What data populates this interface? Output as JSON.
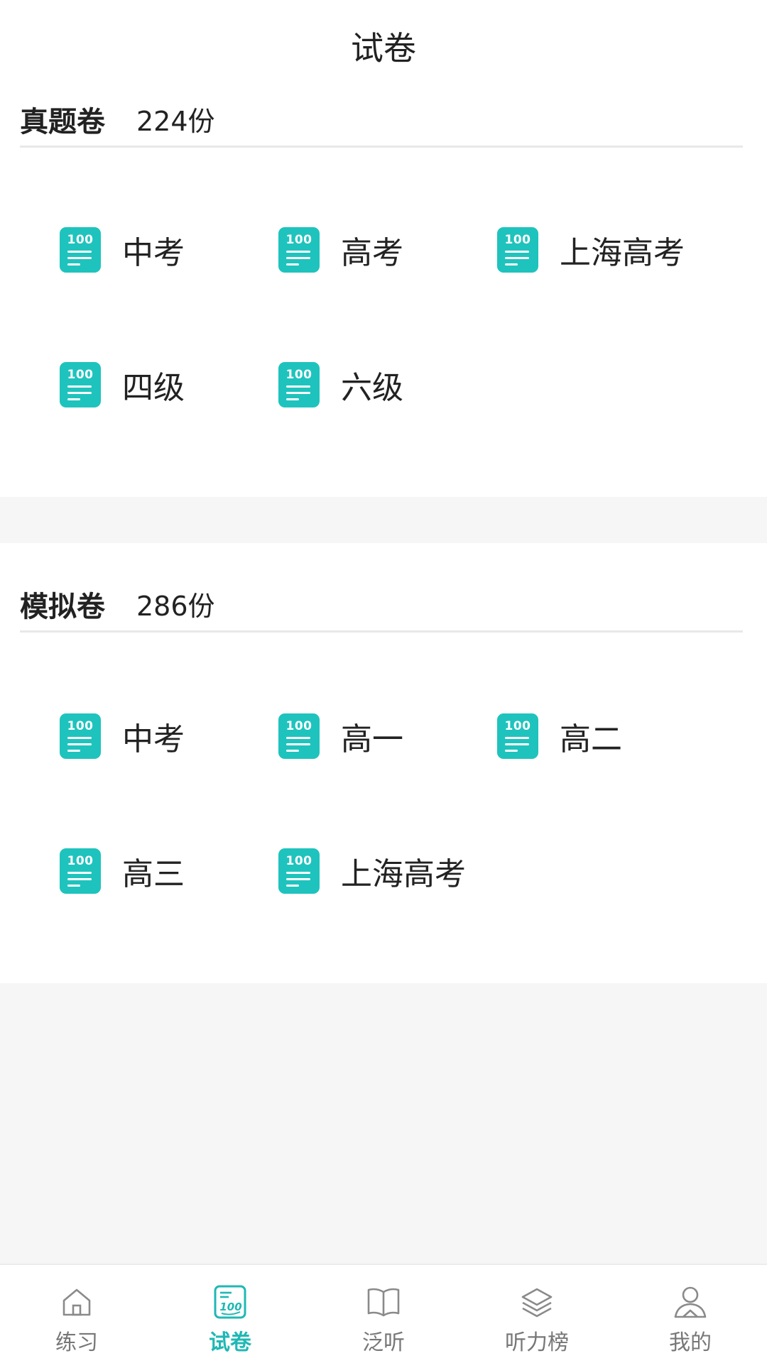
{
  "header": {
    "title": "试卷"
  },
  "sections": [
    {
      "name": "真题卷",
      "count": "224份",
      "items": [
        {
          "icon_text": "100",
          "label": "中考"
        },
        {
          "icon_text": "100",
          "label": "高考"
        },
        {
          "icon_text": "100",
          "label": "上海高考"
        },
        {
          "icon_text": "100",
          "label": "四级"
        },
        {
          "icon_text": "100",
          "label": "六级"
        }
      ]
    },
    {
      "name": "模拟卷",
      "count": "286份",
      "items": [
        {
          "icon_text": "100",
          "label": "中考"
        },
        {
          "icon_text": "100",
          "label": "高一"
        },
        {
          "icon_text": "100",
          "label": "高二"
        },
        {
          "icon_text": "100",
          "label": "高三"
        },
        {
          "icon_text": "100",
          "label": "上海高考"
        }
      ]
    }
  ],
  "tabbar": {
    "items": [
      {
        "label": "练习",
        "icon": "home-icon"
      },
      {
        "label": "试卷",
        "icon": "exam-paper-icon",
        "active": true
      },
      {
        "label": "泛听",
        "icon": "book-icon"
      },
      {
        "label": "听力榜",
        "icon": "layers-icon"
      },
      {
        "label": "我的",
        "icon": "user-icon"
      }
    ]
  },
  "colors": {
    "accent": "#1fc3bd",
    "active_tab": "#1fb8b4",
    "tab_inactive": "#777777",
    "page_bg": "#f6f6f6"
  }
}
